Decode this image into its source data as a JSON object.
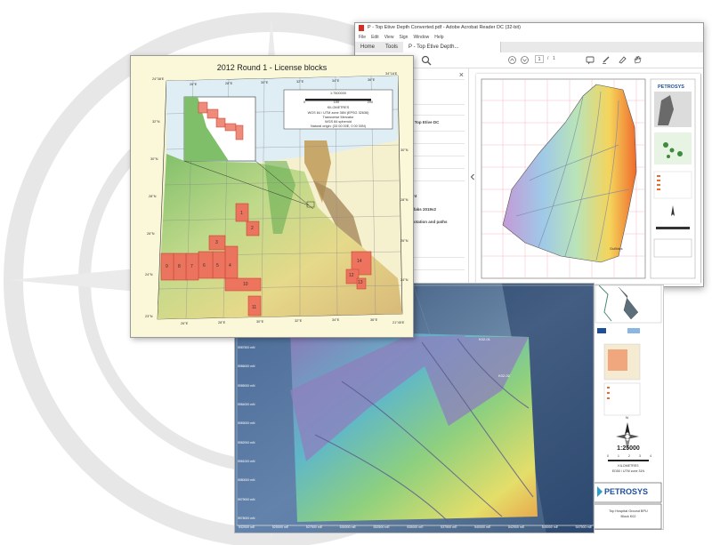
{
  "acrobat": {
    "title": "P - Top Etive Depth Converted.pdf - Adobe Acrobat Reader DC (32-bit)",
    "menu": [
      "File",
      "Edit",
      "View",
      "Sign",
      "Window",
      "Help"
    ],
    "tabs": {
      "home": "Home",
      "tools": "Tools",
      "doc": "P - Top Etive Depth..."
    },
    "page_current": "1",
    "page_sep": "/",
    "page_total": "1",
    "close_glyph": "×",
    "panel_items": [
      "Petrel Top Etive DC",
      "ttement",
      "n Gullfaks 2019v2",
      "s, annotation and paths",
      "ents",
      "bglob"
    ],
    "map_brand": "PETROSYS",
    "map_label": "Gullfaks"
  },
  "license_map": {
    "title": "2012 Round 1 - License blocks",
    "scale_text": "1:7500000",
    "scale_unit": "KILOMETRES",
    "scale_ticks": [
      "0",
      "100",
      "200"
    ],
    "projection_lines": [
      "WGS 84 / UTM zone 36N (EPSG 32636)",
      "Transverse Mercator",
      "WGS 84 spheroid",
      "Natural origin: (33 00 00E, 0 00 00N)"
    ],
    "top_ticks": [
      "26°E",
      "28°E",
      "30°E",
      "32°E",
      "34°E",
      "36°E"
    ],
    "bottom_ticks": [
      "26°E",
      "28°E",
      "30°E",
      "32°E",
      "34°E",
      "36°E"
    ],
    "corner_tl": "24°38'E",
    "corner_tr": "34°16'E",
    "corner_bl": "23°N",
    "corner_br": "21°45'E",
    "lat_left": [
      "32°N",
      "30°N",
      "28°N",
      "26°N",
      "24°N"
    ],
    "lat_right": [
      "30°N",
      "28°N",
      "26°N",
      "24°N"
    ],
    "blocks": [
      "1",
      "2",
      "3",
      "4",
      "5",
      "6",
      "7",
      "8",
      "9",
      "10",
      "11",
      "12",
      "13",
      "14"
    ]
  },
  "bathy": {
    "labels": {
      "k1": "K02-01",
      "k2": "K02-02"
    },
    "x_ticks": [
      "532000 mE",
      "525000 mE",
      "527500 mE",
      "530000 mE",
      "532500 mE",
      "535000 mE",
      "537500 mE",
      "540000 mE",
      "542500 mE",
      "545000 mE",
      "547500 mE"
    ],
    "y_ticks": [
      "5987500 mN",
      "5986000 mN",
      "5985000 mN",
      "5984000 mN",
      "5983000 mN",
      "5982000 mN",
      "5981000 mN",
      "5980000 mN",
      "5979000 mN",
      "5978000 mN"
    ]
  },
  "legend": {
    "north": "N",
    "scale": "1:25000",
    "scale_unit": "KILOMETRES",
    "scale_ticks": [
      "0",
      "1",
      "2",
      "3",
      "4"
    ],
    "projection": "ED50 / UTM zone 31N",
    "brand": "PETROSYS",
    "caption_1": "Top Hospital Ground BPU",
    "caption_2": "Block K02"
  }
}
